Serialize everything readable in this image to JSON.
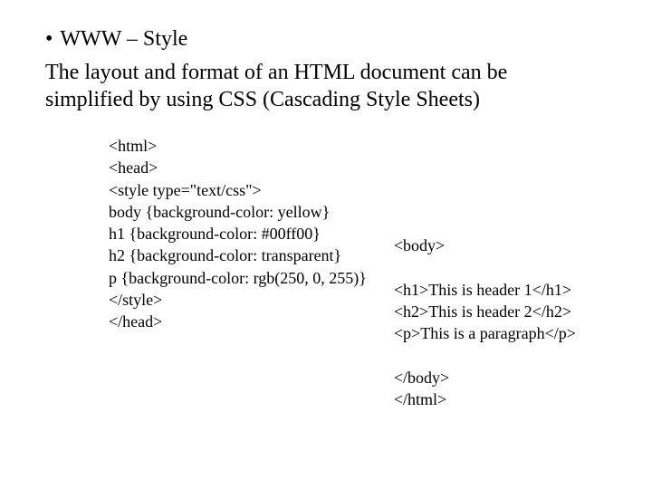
{
  "slide": {
    "bullet": "WWW – Style",
    "description": "The layout and format of an HTML document can be simplified by using CSS (Cascading Style Sheets)",
    "code_left": "<html>\n<head>\n<style type=\"text/css\">\nbody {background-color: yellow}\nh1 {background-color: #00ff00}\nh2 {background-color: transparent}\np {background-color: rgb(250, 0, 255)}\n</style>\n</head>",
    "code_right": "<body>\n\n<h1>This is header 1</h1>\n<h2>This is header 2</h2>\n<p>This is a paragraph</p>\n\n</body>\n</html>"
  }
}
